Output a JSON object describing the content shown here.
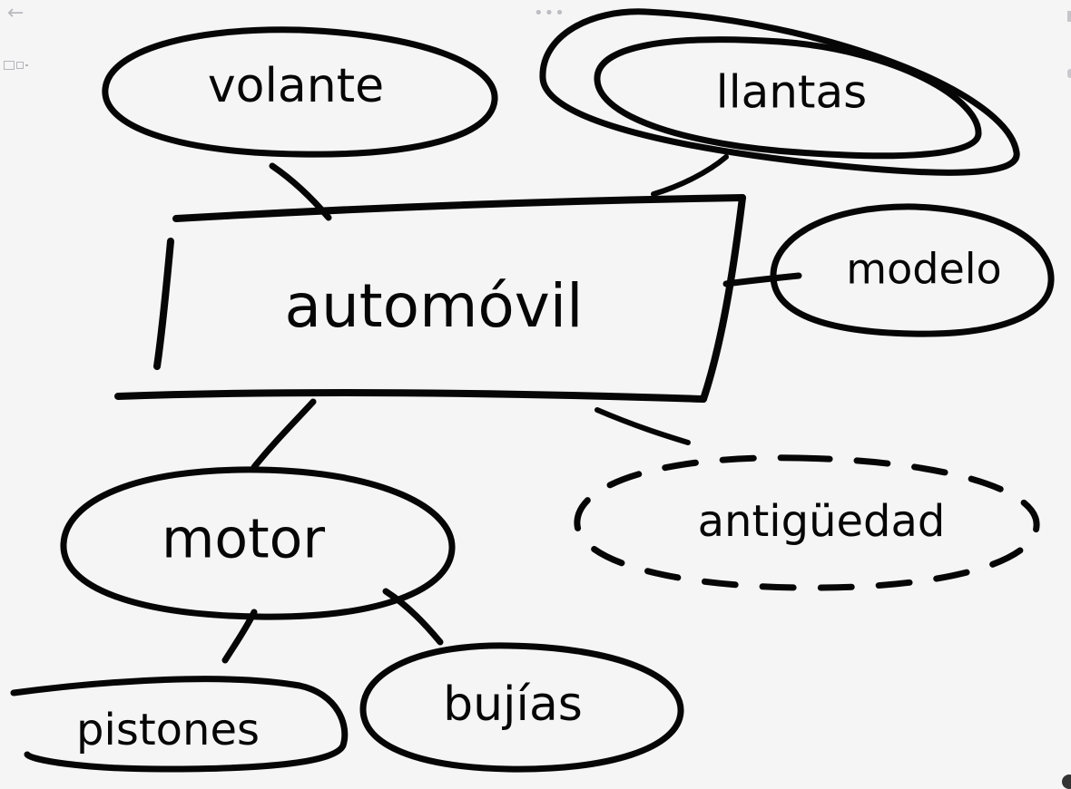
{
  "toolbar": {
    "back_icon": "←",
    "more_icon": "•••"
  },
  "diagram": {
    "entity": "automóvil",
    "attributes": {
      "volante": "volante",
      "llantas": "llantas",
      "modelo": "modelo",
      "antiguedad": "antigüedad",
      "motor": "motor",
      "pistones": "pistones",
      "bujias": "bujías"
    }
  }
}
